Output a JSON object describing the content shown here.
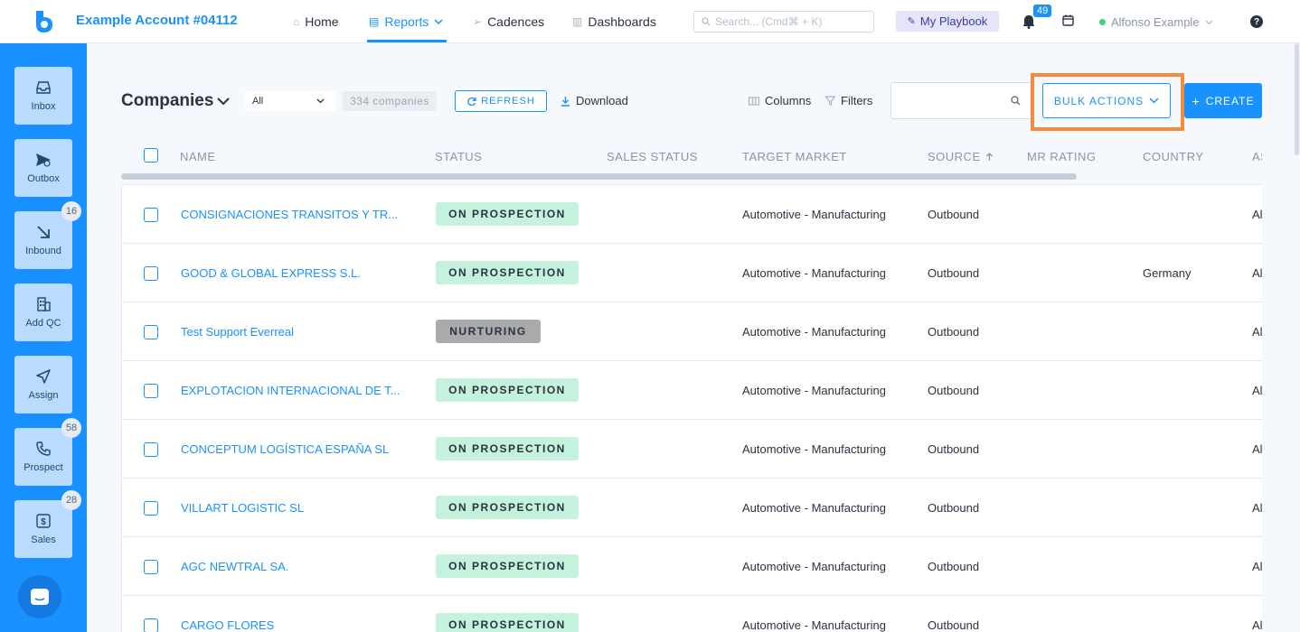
{
  "topbar": {
    "account": "Example Account #04112",
    "nav": [
      {
        "label": "Home"
      },
      {
        "label": "Reports"
      },
      {
        "label": "Cadences"
      },
      {
        "label": "Dashboards"
      }
    ],
    "search_placeholder": "Search... (Cmd⌘ + K)",
    "playbook": "My Playbook",
    "notifications": "49",
    "user": "Alfonso Example"
  },
  "sidebar": [
    {
      "label": "Inbox",
      "icon": "inbox-icon"
    },
    {
      "label": "Outbox",
      "icon": "send-icon"
    },
    {
      "label": "Inbound",
      "icon": "arrow-down-right-icon",
      "badge": "16"
    },
    {
      "label": "Add QC",
      "icon": "building-icon"
    },
    {
      "label": "Assign",
      "icon": "paper-plane-icon"
    },
    {
      "label": "Prospect",
      "icon": "phone-icon",
      "badge": "58"
    },
    {
      "label": "Sales",
      "icon": "dollar-icon",
      "badge": "28"
    }
  ],
  "toolbar": {
    "title": "Companies",
    "filter_value": "All",
    "count": "334 companies",
    "refresh": "REFRESH",
    "download": "Download",
    "columns": "Columns",
    "filters": "Filters",
    "bulk_actions": "BULK ACTIONS",
    "create": "CREATE"
  },
  "table": {
    "headers": [
      "NAME",
      "STATUS",
      "SALES STATUS",
      "TARGET MARKET",
      "SOURCE",
      "MR RATING",
      "COUNTRY",
      "AS"
    ],
    "rows": [
      {
        "name": "CONSIGNACIONES TRANSITOS Y TR...",
        "status": "ON PROSPECTION",
        "target": "Automotive - Manufacturing",
        "source": "Outbound",
        "country": "",
        "as": "Al"
      },
      {
        "name": "GOOD & GLOBAL EXPRESS S.L.",
        "status": "ON PROSPECTION",
        "target": "Automotive - Manufacturing",
        "source": "Outbound",
        "country": "Germany",
        "as": "Al"
      },
      {
        "name": "Test Support Everreal",
        "status": "NURTURING",
        "target": "Automotive - Manufacturing",
        "source": "Outbound",
        "country": "",
        "as": "Al"
      },
      {
        "name": "EXPLOTACION INTERNACIONAL DE T...",
        "status": "ON PROSPECTION",
        "target": "Automotive - Manufacturing",
        "source": "Outbound",
        "country": "",
        "as": "Al"
      },
      {
        "name": "CONCEPTUM LOGÍSTICA ESPAÑA SL",
        "status": "ON PROSPECTION",
        "target": "Automotive - Manufacturing",
        "source": "Outbound",
        "country": "",
        "as": "Al"
      },
      {
        "name": "VILLART LOGISTIC SL",
        "status": "ON PROSPECTION",
        "target": "Automotive - Manufacturing",
        "source": "Outbound",
        "country": "",
        "as": "Al"
      },
      {
        "name": "AGC NEWTRAL SA.",
        "status": "ON PROSPECTION",
        "target": "Automotive - Manufacturing",
        "source": "Outbound",
        "country": "",
        "as": "Al"
      },
      {
        "name": "CARGO FLORES",
        "status": "ON PROSPECTION",
        "target": "Automotive - Manufacturing",
        "source": "Outbound",
        "country": "",
        "as": "Al"
      }
    ]
  },
  "colors": {
    "accent": "#1991ff",
    "highlight": "#f58a3c",
    "prospection": "#c4f2dc",
    "nurturing": "#a9aaab"
  }
}
